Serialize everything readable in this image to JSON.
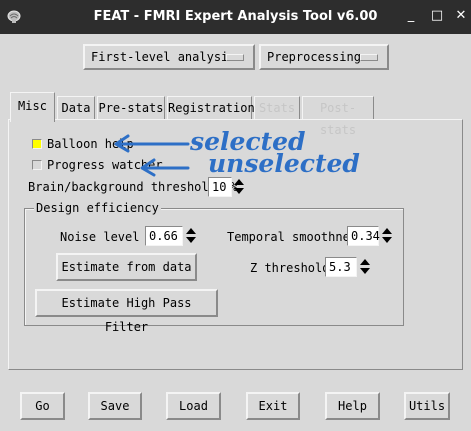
{
  "window": {
    "title": "FEAT - FMRI Expert Analysis Tool v6.00",
    "icon": "feat-app-icon",
    "controls": {
      "minimize": "_",
      "maximize": "□",
      "close": "✕"
    }
  },
  "top_menus": {
    "analysis_level": "First-level analysis",
    "analysis_stage": "Preprocessing"
  },
  "tabs": [
    {
      "label": "Misc",
      "state": "active"
    },
    {
      "label": "Data",
      "state": "normal"
    },
    {
      "label": "Pre-stats",
      "state": "normal"
    },
    {
      "label": "Registration",
      "state": "normal"
    },
    {
      "label": "Stats",
      "state": "disabled"
    },
    {
      "label": "Post-stats",
      "state": "disabled"
    }
  ],
  "misc": {
    "balloon_help": {
      "label": "Balloon help",
      "checked": true
    },
    "progress_watcher": {
      "label": "Progress watcher",
      "checked": false
    },
    "brain_threshold": {
      "label": "Brain/background threshold, %",
      "value": "10"
    }
  },
  "design_efficiency": {
    "title": "Design efficiency",
    "noise_level": {
      "label": "Noise level %",
      "value": "0.66"
    },
    "temporal_smoothness": {
      "label": "Temporal smoothness",
      "value": "0.34"
    },
    "estimate_button": "Estimate from data",
    "z_threshold": {
      "label": "Z threshold",
      "value": "5.3"
    },
    "high_pass_button": "Estimate High Pass Filter"
  },
  "bottom_buttons": {
    "go": "Go",
    "save": "Save",
    "load": "Load",
    "exit": "Exit",
    "help": "Help",
    "utils": "Utils"
  },
  "annotations": {
    "selected": "selected",
    "unselected": "unselected",
    "color": "#2d6fc6"
  },
  "colors": {
    "background": "#d9d9d9",
    "titlebar": "#2d2d2d",
    "checkbox_on": "#ffff00",
    "checkbox_off": "#d9d9d9"
  }
}
